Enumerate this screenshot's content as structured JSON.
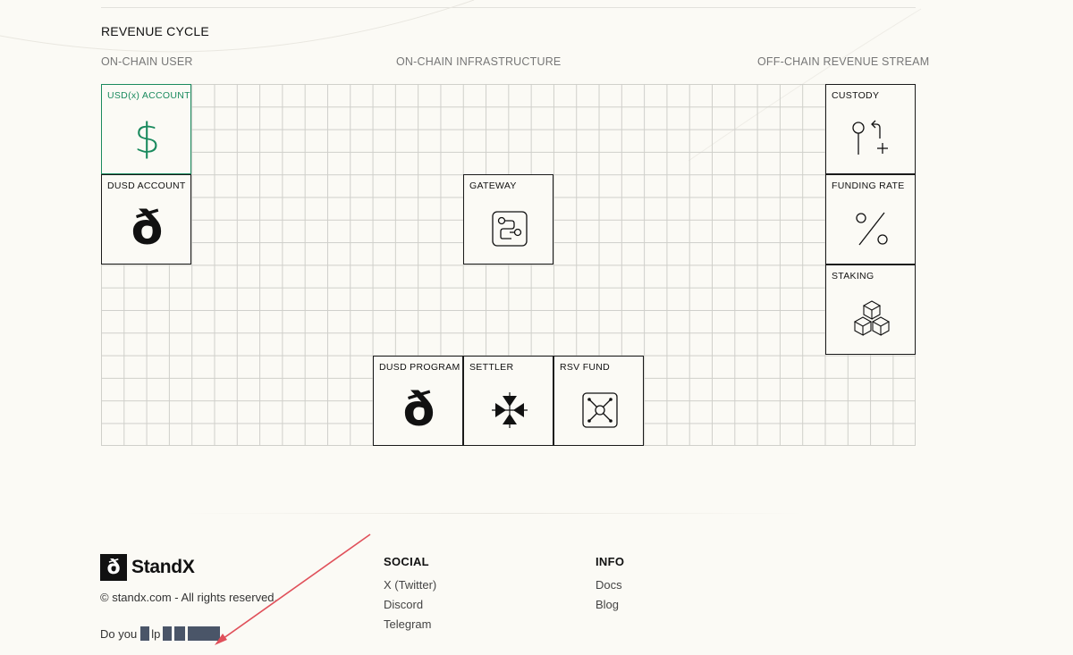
{
  "section": {
    "title": "REVENUE CYCLE",
    "columns": [
      "ON-CHAIN USER",
      "ON-CHAIN INFRASTRUCTURE",
      "OFF-CHAIN REVENUE STREAM"
    ]
  },
  "boxes": {
    "usd_account": {
      "label": "USD(x) ACCOUNT",
      "icon": "dollar-icon",
      "glyph": "$"
    },
    "dusd_account": {
      "label": "DUSD ACCOUNT",
      "icon": "delta-icon",
      "glyph": "ð"
    },
    "gateway": {
      "label": "GATEWAY",
      "icon": "gateway-icon"
    },
    "custody": {
      "label": "CUSTODY",
      "icon": "custody-icon"
    },
    "funding_rate": {
      "label": "FUNDING RATE",
      "icon": "percent-icon"
    },
    "staking": {
      "label": "STAKING",
      "icon": "cubes-icon"
    },
    "dusd_program": {
      "label": "DUSD PROGRAM",
      "icon": "delta-icon",
      "glyph": "ð"
    },
    "settler": {
      "label": "SETTLER",
      "icon": "settler-arrows-icon"
    },
    "rsv_fund": {
      "label": "RSV FUND",
      "icon": "vault-icon"
    }
  },
  "footer": {
    "brand": "StandX",
    "brand_mark": "ð",
    "copyright": "© standx.com - All rights reserved.",
    "prompt": "Do you",
    "prompt_fragment": "lp",
    "social": {
      "heading": "SOCIAL",
      "links": [
        "X (Twitter)",
        "Discord",
        "Telegram"
      ]
    },
    "info": {
      "heading": "INFO",
      "links": [
        "Docs",
        "Blog"
      ]
    }
  },
  "colors": {
    "accent_green": "#1a8a5e",
    "annotation_arrow": "#e0505a",
    "background": "#fbfaf5",
    "redaction": "#4a5568"
  }
}
